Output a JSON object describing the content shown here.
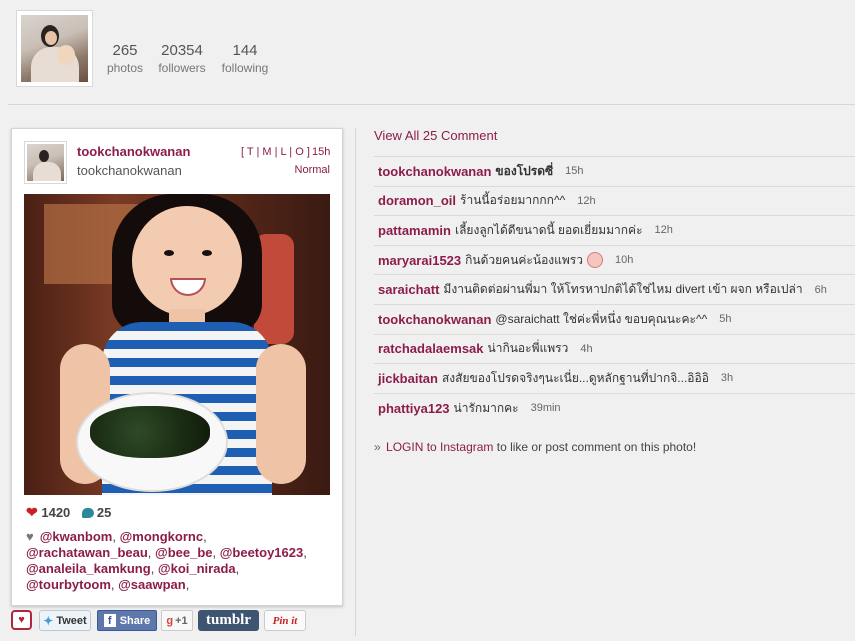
{
  "profile": {
    "stats": [
      {
        "num": "265",
        "label": "photos"
      },
      {
        "num": "20354",
        "label": "followers"
      },
      {
        "num": "144",
        "label": "following"
      }
    ]
  },
  "post": {
    "username": "tookchanokwanan",
    "fullname": "tookchanokwanan",
    "filter_links": "[ T | M | L | O ]",
    "time": "15h",
    "filter": "Normal",
    "likes": "1420",
    "comments_count": "25",
    "tagged_heart": "♥",
    "tagged": [
      "@kwanbom",
      "@mongkornc",
      "@rachatawan_beau",
      "@bee_be",
      "@beetoy1623",
      "@analeila_kamkung",
      "@koi_nirada",
      "@tourbytoom",
      "@saawpan"
    ]
  },
  "share": {
    "tweet": "Tweet",
    "share": "Share",
    "gplus": "+1",
    "gplus_g": "g",
    "tumblr": "tumblr",
    "pin": "Pin it"
  },
  "comments_panel": {
    "view_all": "View All 25 Comment",
    "comments": [
      {
        "user": "tookchanokwanan",
        "text": "ของโปรดซี่",
        "time": "15h"
      },
      {
        "user": "doramon_oil",
        "text": "ร้านนี้อร่อยมากกก^^",
        "time": "12h"
      },
      {
        "user": "pattamamin",
        "text": "เลี้ยงลูกได้ดีขนาดนี้ ยอดเยี่ยมมากค่ะ",
        "time": "12h"
      },
      {
        "user": "maryarai1523",
        "text": "กินด้วยคนค่ะน้องแพรว",
        "time": "10h",
        "emoji": true
      },
      {
        "user": "saraichatt",
        "text": "มีงานติดต่อผ่านพี่มา ให้โทรหาปกติได้ใช่ไหม divert เข้า ผจก หรือเปล่า",
        "time": "6h"
      },
      {
        "user": "tookchanokwanan",
        "text": "@saraichatt ใช่ค่ะพี่หนึ่ง ขอบคุณนะคะ^^",
        "time": "5h"
      },
      {
        "user": "ratchadalaemsak",
        "text": "น่ากินอะพี่แพรว",
        "time": "4h"
      },
      {
        "user": "jickbaitan",
        "text": "สงสัยของโปรดจริงๆนะเนี่ย...ดูหลักฐานที่ปากจิ...อิอิอิ",
        "time": "3h"
      },
      {
        "user": "phattiya123",
        "text": "น่ารักมากคะ",
        "time": "39min"
      }
    ],
    "login_arrow": "»",
    "login_link": "LOGIN to Instagram",
    "login_rest": " to like or post comment on this photo!"
  }
}
